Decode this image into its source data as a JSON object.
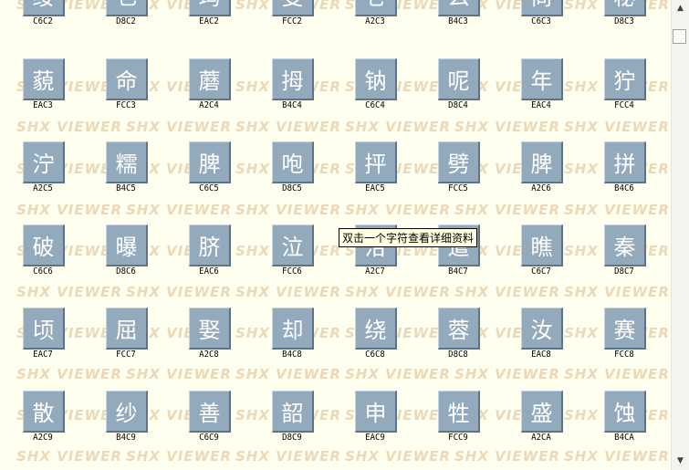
{
  "tooltip_text": "双击一个字符查看详细资料",
  "watermark_text": "SHX VIEWER",
  "rows": [
    [
      {
        "g": "绥",
        "c": "C6C2"
      },
      {
        "g": "乜",
        "c": "D8C2"
      },
      {
        "g": "玛",
        "c": "EAC2"
      },
      {
        "g": "叟",
        "c": "FCC2"
      },
      {
        "g": "仑",
        "c": "A2C3"
      },
      {
        "g": "么",
        "c": "B4C3"
      },
      {
        "g": "尚",
        "c": "C6C3"
      },
      {
        "g": "秘",
        "c": "D8C3"
      }
    ],
    [
      {
        "g": "藐",
        "c": "EAC3"
      },
      {
        "g": "命",
        "c": "FCC3"
      },
      {
        "g": "蘑",
        "c": "A2C4"
      },
      {
        "g": "拇",
        "c": "B4C4"
      },
      {
        "g": "钠",
        "c": "C6C4"
      },
      {
        "g": "呢",
        "c": "D8C4"
      },
      {
        "g": "年",
        "c": "EAC4"
      },
      {
        "g": "狞",
        "c": "FCC4"
      }
    ],
    [
      {
        "g": "泞",
        "c": "A2C5"
      },
      {
        "g": "糯",
        "c": "B4C5"
      },
      {
        "g": "脾",
        "c": "C6C5"
      },
      {
        "g": "咆",
        "c": "D8C5"
      },
      {
        "g": "抨",
        "c": "EAC5"
      },
      {
        "g": "劈",
        "c": "FCC5"
      },
      {
        "g": "脾",
        "c": "A2C6"
      },
      {
        "g": "拼",
        "c": "B4C6"
      }
    ],
    [
      {
        "g": "破",
        "c": "C6C6"
      },
      {
        "g": "曝",
        "c": "D8C6"
      },
      {
        "g": "脐",
        "c": "EAC6"
      },
      {
        "g": "泣",
        "c": "FCC6"
      },
      {
        "g": "洽",
        "c": "A2C7"
      },
      {
        "g": "遣",
        "c": "B4C7"
      },
      {
        "g": "瞧",
        "c": "C6C7"
      },
      {
        "g": "秦",
        "c": "D8C7"
      }
    ],
    [
      {
        "g": "顷",
        "c": "EAC7"
      },
      {
        "g": "屈",
        "c": "FCC7"
      },
      {
        "g": "娶",
        "c": "A2C8"
      },
      {
        "g": "却",
        "c": "B4C8"
      },
      {
        "g": "绕",
        "c": "C6C8"
      },
      {
        "g": "蓉",
        "c": "D8C8"
      },
      {
        "g": "汝",
        "c": "EAC8"
      },
      {
        "g": "赛",
        "c": "FCC8"
      }
    ],
    [
      {
        "g": "散",
        "c": "A2C9"
      },
      {
        "g": "纱",
        "c": "B4C9"
      },
      {
        "g": "善",
        "c": "C6C9"
      },
      {
        "g": "韶",
        "c": "D8C9"
      },
      {
        "g": "申",
        "c": "EAC9"
      },
      {
        "g": "牲",
        "c": "FCC9"
      },
      {
        "g": "盛",
        "c": "A2CA"
      },
      {
        "g": "蚀",
        "c": "B4CA"
      }
    ]
  ],
  "scrollbar": {
    "up_arrow": "▲",
    "down_arrow": "▼"
  }
}
